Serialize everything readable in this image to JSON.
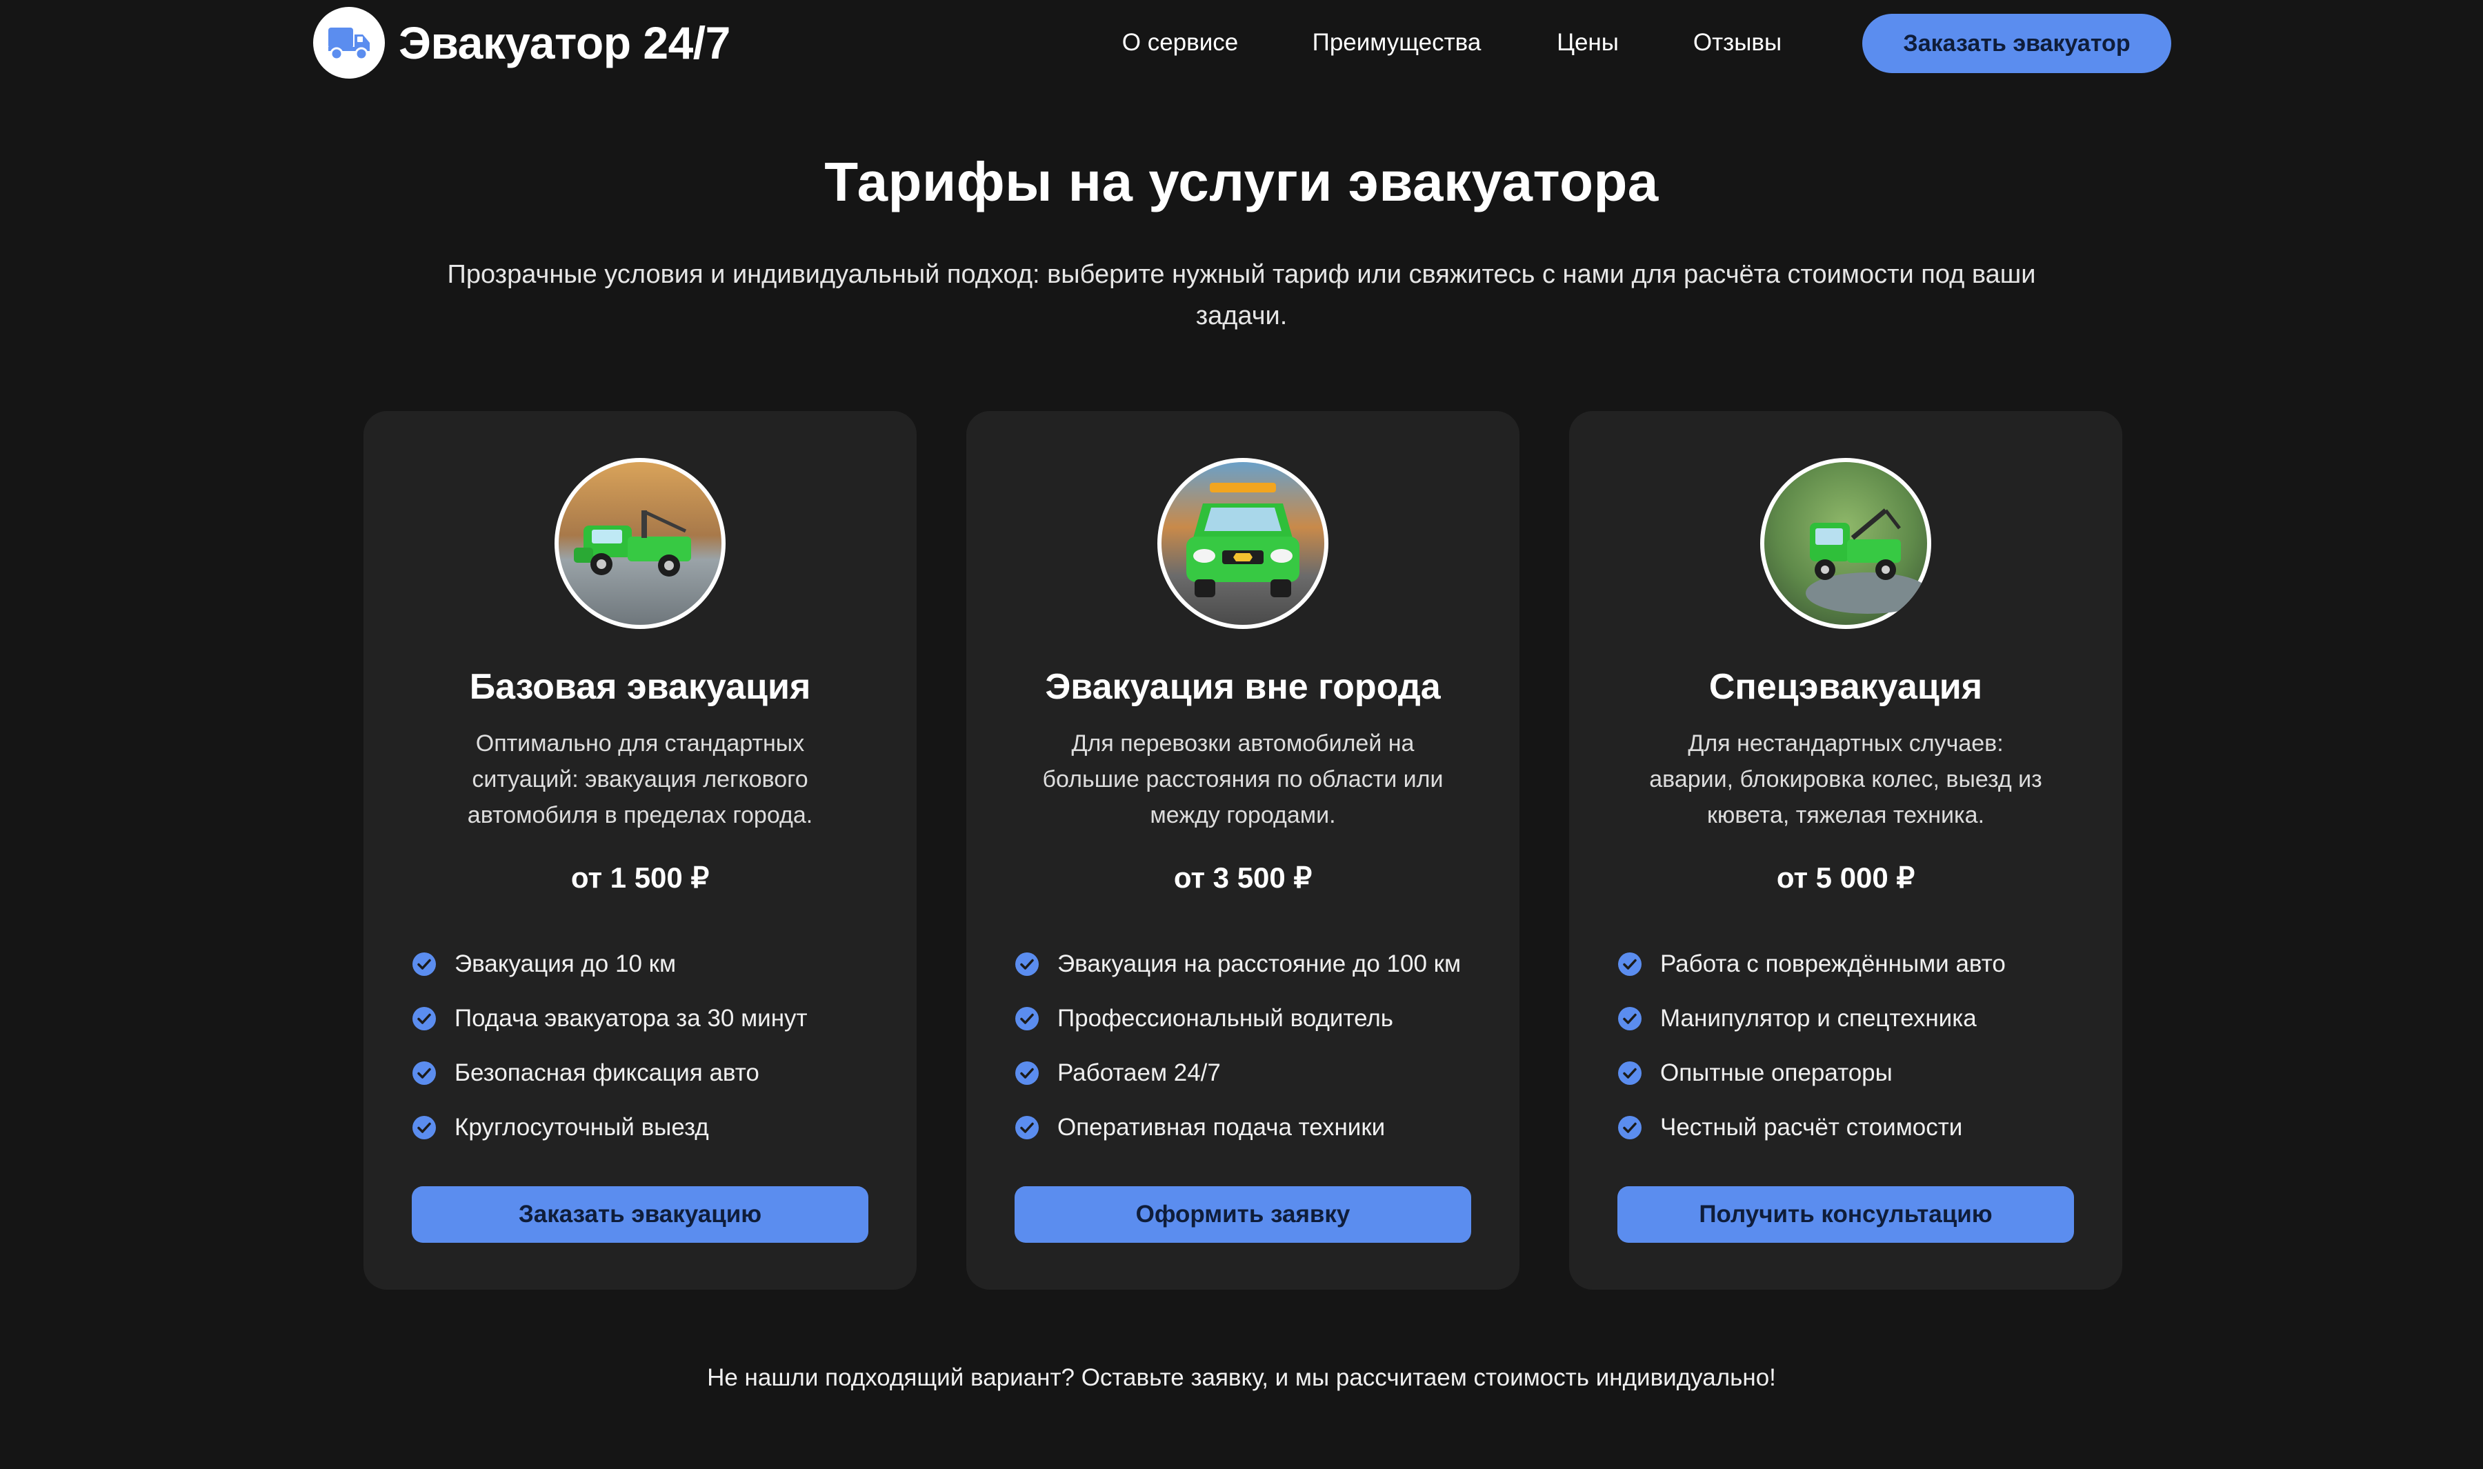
{
  "brand": {
    "name": "Эвакуатор 24/7",
    "logo_icon": "truck-icon"
  },
  "nav": {
    "items": [
      {
        "label": "О сервисе"
      },
      {
        "label": "Преимущества"
      },
      {
        "label": "Цены"
      },
      {
        "label": "Отзывы"
      }
    ],
    "cta_label": "Заказать эвакуатор"
  },
  "colors": {
    "background": "#151515",
    "card": "#222222",
    "accent": "#5b8def",
    "accent_text": "#0f1d3a"
  },
  "hero": {
    "title": "Тарифы на услуги эвакуатора",
    "subtitle": "Прозрачные условия и индивидуальный подход: выберите нужный тариф или свяжитесь с нами для расчёта стоимости под ваши задачи."
  },
  "plans": [
    {
      "image": "green-tow-truck-photo",
      "title": "Базовая эвакуация",
      "description": "Оптимально для стандартных ситуаций: эвакуация легкового автомобиля в пределах города.",
      "price": "от 1 500 ₽",
      "features": [
        "Эвакуация до 10 км",
        "Подача эвакуатора за 30 минут",
        "Безопасная фиксация авто",
        "Круглосуточный выезд"
      ],
      "button": "Заказать эвакуацию"
    },
    {
      "image": "green-tow-truck-front-photo",
      "title": "Эвакуация вне города",
      "description": "Для перевозки автомобилей на большие расстояния по области или между городами.",
      "price": "от 3 500 ₽",
      "features": [
        "Эвакуация на расстояние до 100 км",
        "Профессиональный водитель",
        "Работаем 24/7",
        "Оперативная подача техники"
      ],
      "button": "Оформить заявку"
    },
    {
      "image": "green-manipulator-truck-photo",
      "title": "Спецэвакуация",
      "description": "Для нестандартных случаев: аварии, блокировка колес, выезд из кювета, тяжелая техника.",
      "price": "от 5 000 ₽",
      "features": [
        "Работа с повреждёнными авто",
        "Манипулятор и спецтехника",
        "Опытные операторы",
        "Честный расчёт стоимости"
      ],
      "button": "Получить консультацию"
    }
  ],
  "footer_note": "Не нашли подходящий вариант? Оставьте заявку, и мы рассчитаем стоимость индивидуально!"
}
